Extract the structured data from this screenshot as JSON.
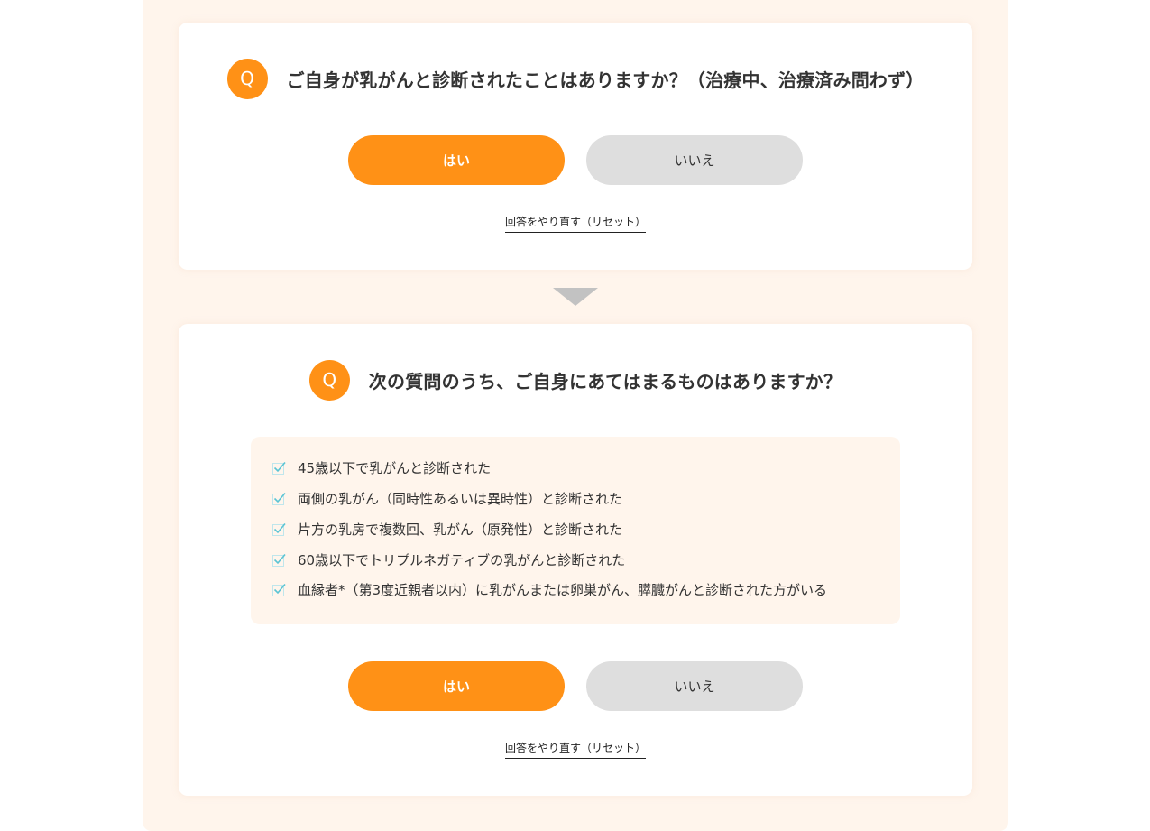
{
  "colors": {
    "accent": "#ff9116",
    "panel_background": "#fff5ec",
    "no_button": "#dedede",
    "arrow": "#c2c2c2",
    "check": "#5bc4d4"
  },
  "question1": {
    "badge": "Q",
    "text": "ご自身が乳がんと診断されたことはありますか？（治療中、治療済み問わず）",
    "yes_label": "はい",
    "no_label": "いいえ",
    "reset_label": "回答をやり直す（リセット）"
  },
  "question2": {
    "badge": "Q",
    "text": "次の質問のうち、ご自身にあてはまるものはありますか？",
    "criteria": [
      {
        "icon": "check-icon",
        "text": "45歳以下で乳がんと診断された"
      },
      {
        "icon": "check-icon",
        "text": "両側の乳がん（同時性あるいは異時性）と診断された"
      },
      {
        "icon": "check-icon",
        "text": "片方の乳房で複数回、乳がん（原発性）と診断された"
      },
      {
        "icon": "check-icon",
        "text": "60歳以下でトリプルネガティブの乳がんと診断された"
      },
      {
        "icon": "check-icon",
        "text": "血縁者*（第3度近親者以内）に乳がんまたは卵巣がん、膵臓がんと診断された方がいる"
      }
    ],
    "yes_label": "はい",
    "no_label": "いいえ",
    "reset_label": "回答をやり直す（リセット）"
  }
}
